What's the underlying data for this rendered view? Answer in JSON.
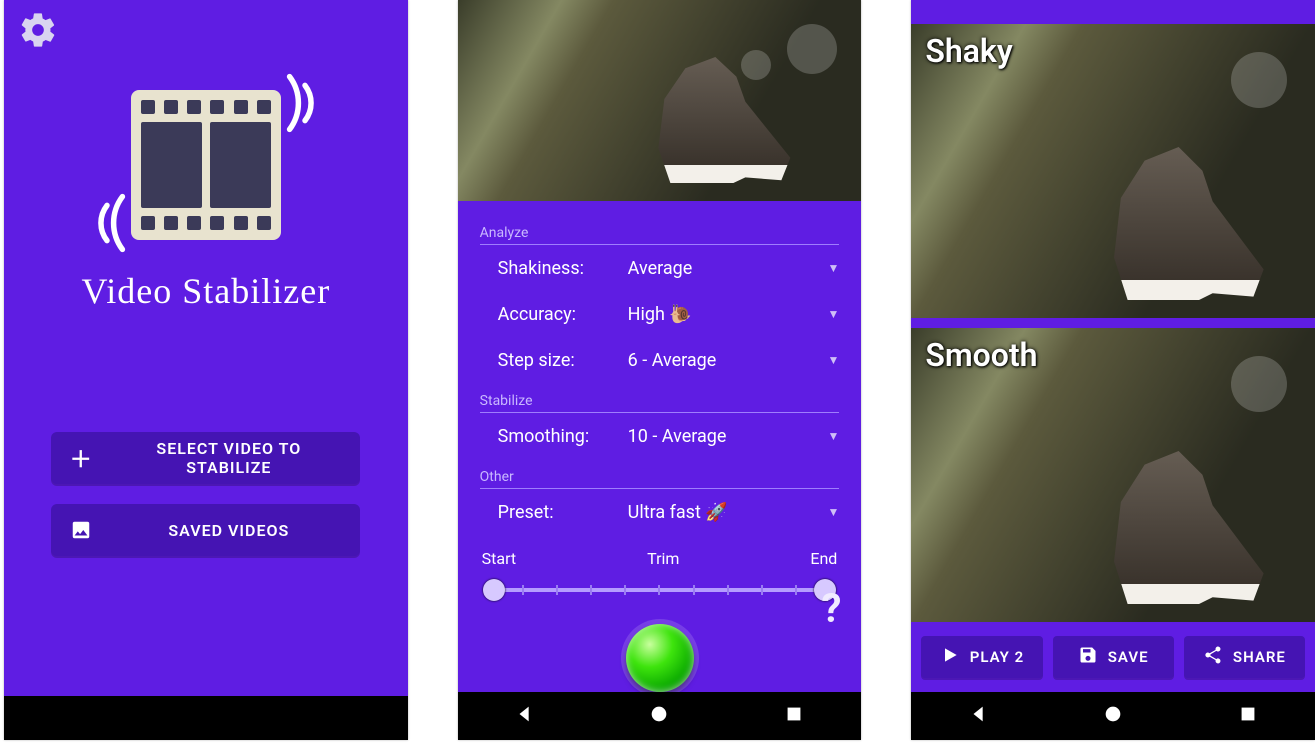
{
  "screen1": {
    "title": "Video Stabilizer",
    "select_label": "SELECT VIDEO TO STABILIZE",
    "saved_label": "SAVED VIDEOS"
  },
  "screen2": {
    "sections": {
      "analyze": "Analyze",
      "stabilize": "Stabilize",
      "other": "Other"
    },
    "shakiness": {
      "label": "Shakiness:",
      "value": "Average"
    },
    "accuracy": {
      "label": "Accuracy:",
      "value": "High 🐌"
    },
    "stepsize": {
      "label": "Step size:",
      "value": "6 - Average"
    },
    "smoothing": {
      "label": "Smoothing:",
      "value": "10 - Average"
    },
    "preset": {
      "label": "Preset:",
      "value": "Ultra fast 🚀"
    },
    "trim": {
      "start": "Start",
      "label": "Trim",
      "end": "End"
    },
    "help": "?"
  },
  "screen3": {
    "label_shaky": "Shaky",
    "label_smooth": "Smooth",
    "play_label": "PLAY 2",
    "save_label": "SAVE",
    "share_label": "SHARE"
  }
}
